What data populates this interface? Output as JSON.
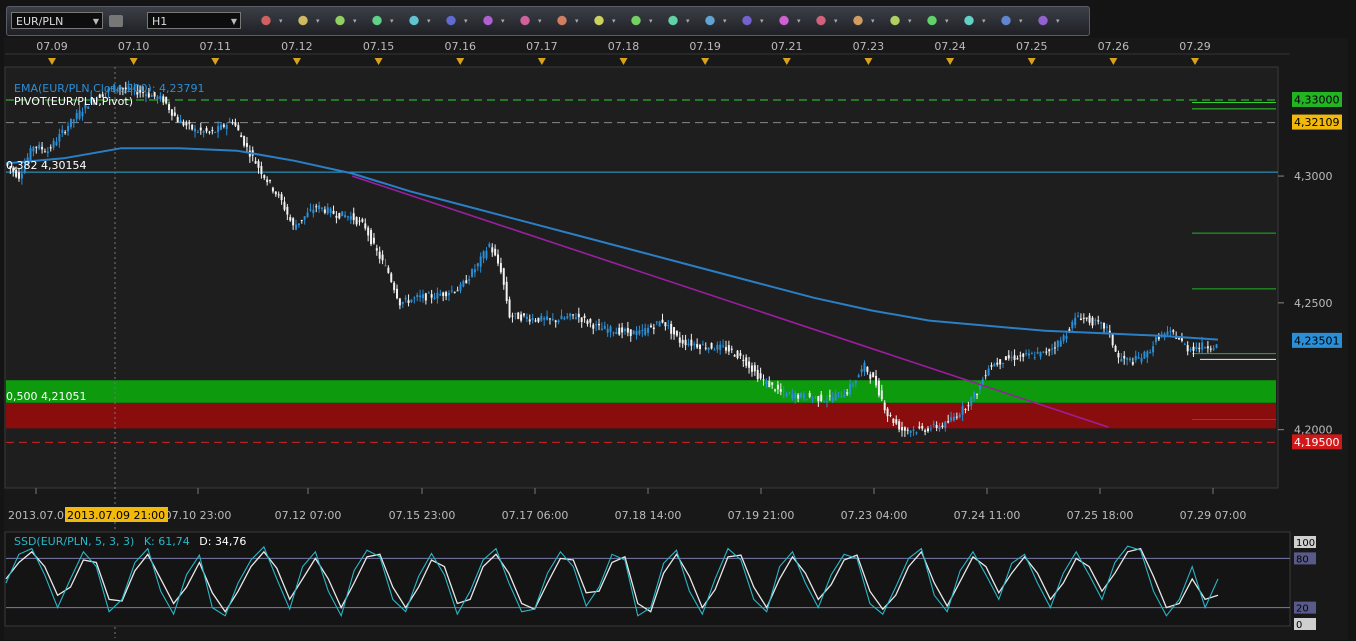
{
  "toolbar": {
    "symbol": "EUR/PLN",
    "timeframe": "H1",
    "buttons": [
      "bar-chart-icon",
      "candle-icon",
      "line-chart-icon",
      "table-icon",
      "cursor-icon",
      "crosshair-icon",
      "text-icon",
      "pencil-icon",
      "eye-icon",
      "globe-icon",
      "ruler-icon",
      "image-icon",
      "window-icon",
      "fib-icon",
      "channel-icon",
      "trend-icon",
      "line-icon",
      "ellipse-icon",
      "abc-icon",
      "eraser-icon",
      "tree-icon",
      "menu-icon"
    ]
  },
  "chart_data": [
    {
      "type": "candlestick",
      "title": "",
      "legend": [
        {
          "text": "EMA(EUR/PLN,Close,200): 4,23791",
          "color": "#2a8fd6"
        },
        {
          "text": "PIVOT(EUR/PLN,Pivot)",
          "color": "#ffffff"
        }
      ],
      "top_dates": [
        "07.09",
        "07.10",
        "07.11",
        "07.12",
        "07.15",
        "07.16",
        "07.17",
        "07.18",
        "07.19",
        "07.21",
        "07.23",
        "07.24",
        "07.25",
        "07.26",
        "07.29"
      ],
      "x_ticks": [
        "2013.07.0",
        "07.10 23:00",
        "07.12 07:00",
        "07.15 23:00",
        "07.17 06:00",
        "07.18 14:00",
        "07.19 21:00",
        "07.23 04:00",
        "07.24 11:00",
        "07.25 18:00",
        "07.29 07:00"
      ],
      "crosshair_label": "2013.07.09 21:00",
      "y_ticks": [
        "4,3000",
        "4,2500",
        "4,2000"
      ],
      "ylim": [
        4.177,
        4.343
      ],
      "price_labels": [
        {
          "value": 4.33,
          "text": "4,33000",
          "bg": "#22b422",
          "fg": "#000000"
        },
        {
          "value": 4.32109,
          "text": "4,32109",
          "bg": "#f2b90c",
          "fg": "#000000"
        },
        {
          "value": 4.23501,
          "text": "4,23501",
          "bg": "#2a8fd6",
          "fg": "#000000"
        },
        {
          "value": 4.195,
          "text": "4,19500",
          "bg": "#d01818",
          "fg": "#ffffff"
        }
      ],
      "fib_levels": [
        {
          "text": "0,382 4,30154",
          "value": 4.30154
        },
        {
          "text": "0,500 4,21051",
          "value": 4.21051
        }
      ],
      "zones": [
        {
          "name": "green-zone",
          "from": 4.2106,
          "to": 4.2195,
          "color": "#0d9a0d"
        },
        {
          "name": "red-zone",
          "from": 4.2005,
          "to": 4.2105,
          "color": "#8a0d0d"
        }
      ],
      "price_path": [
        [
          0,
          4.305
        ],
        [
          5,
          4.3
        ],
        [
          10,
          4.312
        ],
        [
          15,
          4.31
        ],
        [
          22,
          4.32
        ],
        [
          30,
          4.33
        ],
        [
          38,
          4.335
        ],
        [
          48,
          4.333
        ],
        [
          55,
          4.33
        ],
        [
          60,
          4.322
        ],
        [
          66,
          4.318
        ],
        [
          72,
          4.317
        ],
        [
          79,
          4.322
        ],
        [
          84,
          4.311
        ],
        [
          90,
          4.3
        ],
        [
          96,
          4.29
        ],
        [
          100,
          4.28
        ],
        [
          108,
          4.288
        ],
        [
          115,
          4.285
        ],
        [
          120,
          4.284
        ],
        [
          125,
          4.28
        ],
        [
          128,
          4.272
        ],
        [
          133,
          4.262
        ],
        [
          137,
          4.25
        ],
        [
          143,
          4.252
        ],
        [
          150,
          4.253
        ],
        [
          158,
          4.256
        ],
        [
          164,
          4.265
        ],
        [
          168,
          4.273
        ],
        [
          172,
          4.263
        ],
        [
          175,
          4.245
        ],
        [
          182,
          4.244
        ],
        [
          190,
          4.243
        ],
        [
          198,
          4.245
        ],
        [
          206,
          4.24
        ],
        [
          212,
          4.239
        ],
        [
          220,
          4.238
        ],
        [
          228,
          4.243
        ],
        [
          234,
          4.235
        ],
        [
          242,
          4.233
        ],
        [
          250,
          4.232
        ],
        [
          256,
          4.228
        ],
        [
          262,
          4.22
        ],
        [
          270,
          4.214
        ],
        [
          278,
          4.213
        ],
        [
          285,
          4.212
        ],
        [
          292,
          4.215
        ],
        [
          298,
          4.225
        ],
        [
          302,
          4.218
        ],
        [
          306,
          4.206
        ],
        [
          311,
          4.2
        ],
        [
          318,
          4.2
        ],
        [
          326,
          4.202
        ],
        [
          332,
          4.208
        ],
        [
          337,
          4.215
        ],
        [
          341,
          4.225
        ],
        [
          347,
          4.228
        ],
        [
          353,
          4.229
        ],
        [
          360,
          4.23
        ],
        [
          366,
          4.235
        ],
        [
          372,
          4.245
        ],
        [
          378,
          4.242
        ],
        [
          382,
          4.24
        ],
        [
          386,
          4.228
        ],
        [
          391,
          4.227
        ],
        [
          396,
          4.23
        ],
        [
          400,
          4.237
        ],
        [
          405,
          4.238
        ],
        [
          410,
          4.232
        ],
        [
          415,
          4.233
        ],
        [
          420,
          4.233
        ]
      ],
      "ema_path": [
        [
          0,
          4.305
        ],
        [
          20,
          4.307
        ],
        [
          40,
          4.311
        ],
        [
          60,
          4.311
        ],
        [
          80,
          4.31
        ],
        [
          100,
          4.306
        ],
        [
          120,
          4.301
        ],
        [
          140,
          4.294
        ],
        [
          160,
          4.288
        ],
        [
          180,
          4.282
        ],
        [
          200,
          4.276
        ],
        [
          220,
          4.27
        ],
        [
          240,
          4.264
        ],
        [
          260,
          4.258
        ],
        [
          280,
          4.252
        ],
        [
          300,
          4.247
        ],
        [
          320,
          4.243
        ],
        [
          340,
          4.241
        ],
        [
          360,
          4.239
        ],
        [
          380,
          4.238
        ],
        [
          400,
          4.237
        ],
        [
          420,
          4.2355
        ]
      ],
      "trend_line": [
        [
          120,
          4.3
        ],
        [
          382,
          4.201
        ]
      ],
      "horizontal_lines": [
        {
          "value": 4.33,
          "color": "#2fd12f",
          "dash": true
        },
        {
          "value": 4.32109,
          "color": "#888888",
          "dash": true
        },
        {
          "value": 4.30154,
          "color": "#2aa8d8",
          "dash": false
        },
        {
          "value": 4.195,
          "color": "#d02020",
          "dash": true
        }
      ],
      "pivot_steps": [
        4.329,
        4.3265,
        4.2775,
        4.2555,
        4.23,
        4.204
      ]
    },
    {
      "type": "line",
      "title": "SSD(EUR/PLN, 5, 3, 3)",
      "k_label": "K: 61,74",
      "d_label": "D: 34,76",
      "ylim": [
        0,
        100
      ],
      "y_ticks": [
        "100",
        "80",
        "20",
        "0"
      ],
      "levels": [
        80,
        20
      ],
      "k_values": [
        50,
        85,
        92,
        60,
        20,
        55,
        88,
        70,
        15,
        30,
        75,
        92,
        40,
        12,
        60,
        84,
        20,
        10,
        50,
        78,
        94,
        55,
        18,
        70,
        88,
        40,
        10,
        65,
        90,
        82,
        30,
        15,
        58,
        86,
        60,
        12,
        40,
        78,
        92,
        50,
        15,
        18,
        62,
        88,
        70,
        22,
        45,
        85,
        78,
        10,
        20,
        74,
        90,
        40,
        12,
        55,
        92,
        78,
        30,
        15,
        70,
        88,
        50,
        20,
        60,
        85,
        80,
        25,
        12,
        45,
        80,
        92,
        35,
        15,
        65,
        88,
        60,
        30,
        74,
        85,
        50,
        20,
        62,
        88,
        60,
        30,
        75,
        95,
        90,
        40,
        10,
        30,
        70,
        20,
        55
      ],
      "d_values": [
        55,
        75,
        88,
        70,
        35,
        45,
        78,
        75,
        30,
        28,
        65,
        85,
        55,
        25,
        45,
        75,
        38,
        15,
        40,
        70,
        88,
        68,
        30,
        55,
        80,
        55,
        20,
        50,
        82,
        85,
        45,
        20,
        45,
        78,
        70,
        25,
        30,
        70,
        85,
        62,
        25,
        18,
        50,
        80,
        78,
        38,
        40,
        75,
        82,
        25,
        15,
        62,
        85,
        58,
        20,
        42,
        82,
        84,
        45,
        20,
        55,
        82,
        62,
        30,
        48,
        78,
        84,
        40,
        18,
        35,
        70,
        88,
        50,
        22,
        52,
        82,
        70,
        38,
        62,
        82,
        62,
        30,
        50,
        80,
        70,
        40,
        62,
        88,
        92,
        58,
        20,
        25,
        55,
        30,
        35
      ]
    }
  ]
}
